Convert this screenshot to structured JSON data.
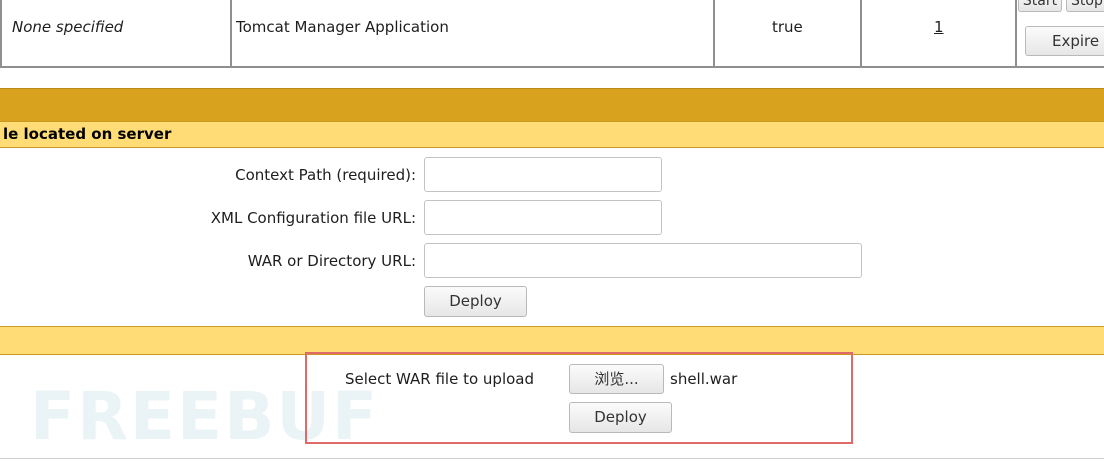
{
  "top_row": {
    "display_name": "None specified",
    "description": "Tomcat Manager Application",
    "running": "true",
    "sessions": "1",
    "commands": {
      "start_label": "Start",
      "stop_label": "Stop",
      "expire_label": "Expire s"
    }
  },
  "deploy_server": {
    "section_title": "le located on server",
    "context_path_label": "Context Path (required):",
    "context_path_value": "",
    "xml_config_label": "XML Configuration file URL:",
    "xml_config_value": "",
    "war_dir_label": "WAR or Directory URL:",
    "war_dir_value": "",
    "deploy_label": "Deploy"
  },
  "upload": {
    "select_label": "Select WAR file to upload",
    "browse_label": "浏览...",
    "file_name": "shell.war",
    "deploy_label": "Deploy"
  },
  "watermark": {
    "text": "FREEBUF"
  },
  "colors": {
    "band_dark": "#d9a21e",
    "band_light": "#ffdc75",
    "highlight": "#e06a6a"
  }
}
